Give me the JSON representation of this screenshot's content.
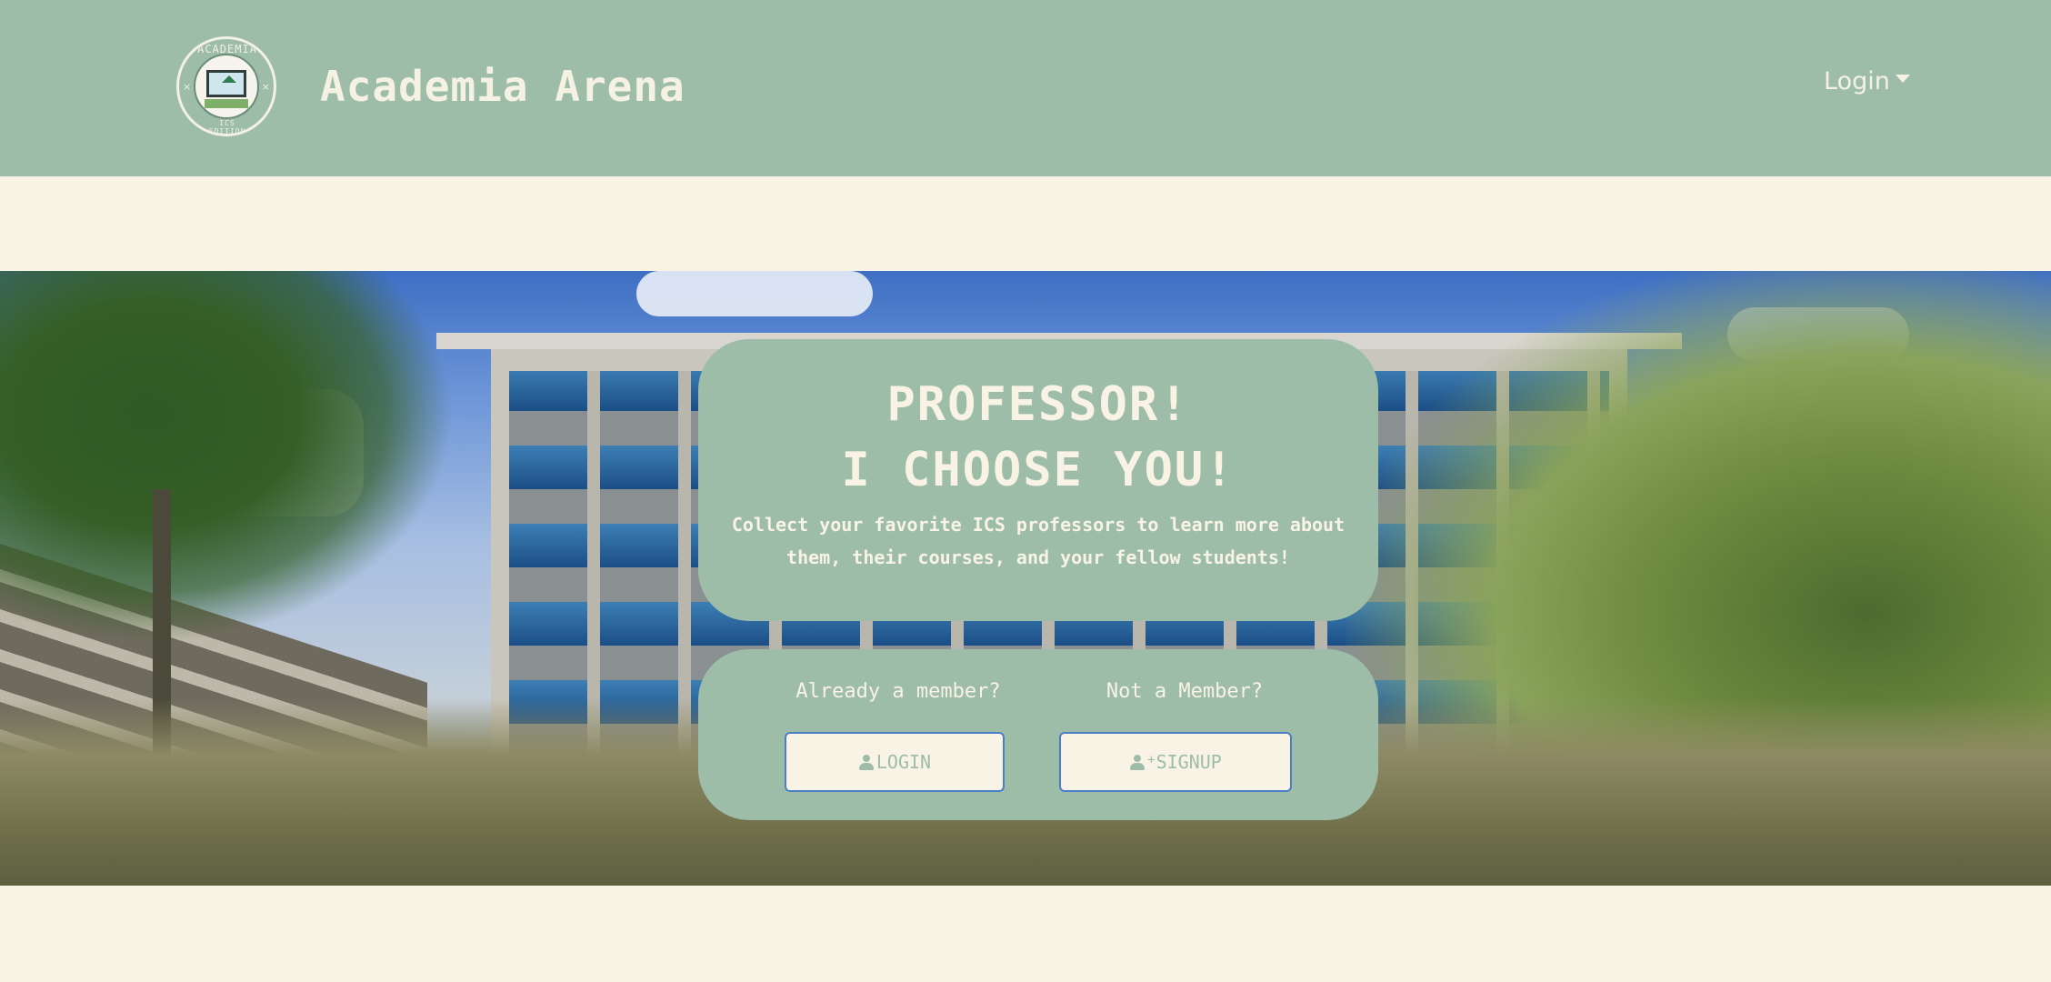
{
  "nav": {
    "brand": "Academia Arena",
    "logo_text": "ACADEMIA ARENA",
    "logo_subtext": "ICS EDITION",
    "login_menu": "Login"
  },
  "hero": {
    "title_line1": "PROFESSOR!",
    "title_line2": "I CHOOSE YOU!",
    "subtitle": "Collect your favorite ICS professors to learn more about them, their courses, and your fellow students!"
  },
  "actions": {
    "member_prompt": "Already a member?",
    "nonmember_prompt": "Not a Member?",
    "login_label": "LOGIN",
    "signup_label": "SIGNUP"
  },
  "colors": {
    "primary": "#9dbda9",
    "background": "#f8f3e4",
    "button_border": "#4a7fc7"
  }
}
